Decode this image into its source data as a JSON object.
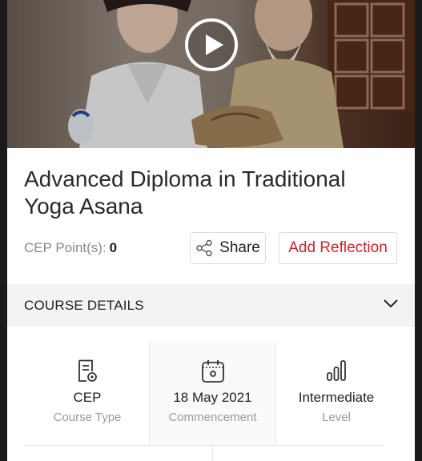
{
  "course": {
    "title": "Advanced Diploma in Traditional Yoga Asana",
    "cep_label": "CEP Point(s):",
    "cep_value": "0"
  },
  "actions": {
    "share_label": "Share",
    "reflection_label": "Add Reflection"
  },
  "details": {
    "header": "COURSE DETAILS",
    "items": [
      {
        "value": "CEP",
        "label": "Course Type",
        "icon": "document-badge-icon"
      },
      {
        "value": "18 May 2021",
        "label": "Commencement",
        "icon": "calendar-icon"
      },
      {
        "value": "Intermediate",
        "label": "Level",
        "icon": "bar-level-icon"
      }
    ]
  },
  "colors": {
    "accent": "#d2222d",
    "section_bg": "#f3f3f3"
  }
}
